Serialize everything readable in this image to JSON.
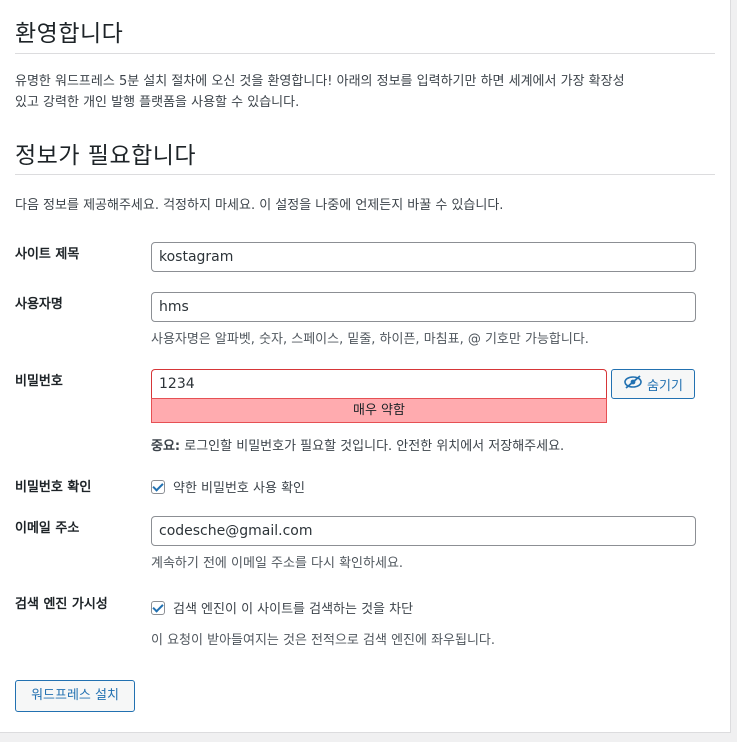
{
  "welcome": {
    "heading": "환영합니다",
    "body_line1": "유명한 워드프레스 5분 설치 절차에 오신 것을 환영합니다! 아래의 정보를 입력하기만 하면 세계에서 가장 확장성",
    "body_line2": "있고 강력한 개인 발행 플랫폼을 사용할 수 있습니다."
  },
  "info": {
    "heading": "정보가 필요합니다",
    "intro": "다음 정보를 제공해주세요. 걱정하지 마세요. 이 설정을 나중에 언제든지 바꿀 수 있습니다."
  },
  "form": {
    "site_title": {
      "label": "사이트 제목",
      "value": "kostagram"
    },
    "username": {
      "label": "사용자명",
      "value": "hms",
      "help": "사용자명은 알파벳, 숫자, 스페이스, 밑줄, 하이픈, 마침표, @ 기호만 가능합니다."
    },
    "password": {
      "label": "비밀번호",
      "value": "1234",
      "strength": "매우 약함",
      "hide_button": "숨기기",
      "note_strong": "중요:",
      "note": "로그인할 비밀번호가 필요할 것입니다. 안전한 위치에서 저장해주세요."
    },
    "confirm_password": {
      "label": "비밀번호 확인",
      "checkbox_label": "약한 비밀번호 사용 확인",
      "checked": true
    },
    "email": {
      "label": "이메일 주소",
      "value": "codesche@gmail.com",
      "help": "계속하기 전에 이메일 주소를 다시 확인하세요."
    },
    "search_visibility": {
      "label": "검색 엔진 가시성",
      "checkbox_label": "검색 엔진이 이 사이트를 검색하는 것을 차단",
      "checked": true,
      "help": "이 요청이 받아들여지는 것은 전적으로 검색 엔진에 좌우됩니다."
    }
  },
  "install_button": "워드프레스 설치",
  "colors": {
    "accent": "#2271b1",
    "weak_bg": "#ffabaf",
    "weak_border": "#d63638"
  },
  "icons": {
    "hide_password": "eye-slash-icon"
  }
}
